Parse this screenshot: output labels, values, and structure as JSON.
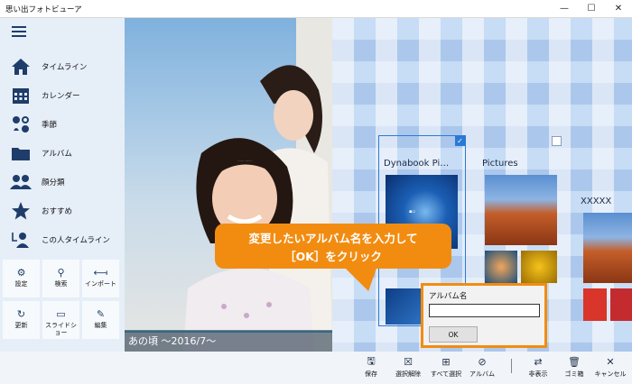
{
  "window": {
    "title": "思い出フォトビューア",
    "controls": {
      "minimize": "—",
      "maximize": "☐",
      "close": "✕"
    }
  },
  "sidebar": {
    "menu_icon": "hamburger-icon",
    "nav": [
      {
        "label": "タイムライン",
        "icon": "home-icon"
      },
      {
        "label": "カレンダー",
        "icon": "calendar-icon"
      },
      {
        "label": "季節",
        "icon": "seasons-icon"
      },
      {
        "label": "アルバム",
        "icon": "folder-icon"
      },
      {
        "label": "顔分類",
        "icon": "faces-icon"
      },
      {
        "label": "おすすめ",
        "icon": "star-icon"
      },
      {
        "label": "この人タイムライン",
        "icon": "person-timeline-icon"
      }
    ],
    "tiles": [
      {
        "label": "設定",
        "icon": "gear-icon",
        "glyph": "⚙"
      },
      {
        "label": "検索",
        "icon": "search-icon",
        "glyph": "⚲"
      },
      {
        "label": "インポート",
        "icon": "import-icon",
        "glyph": "⟻"
      },
      {
        "label": "更新",
        "icon": "refresh-icon",
        "glyph": "↻"
      },
      {
        "label": "スライドショー",
        "icon": "slideshow-icon",
        "glyph": "▭"
      },
      {
        "label": "編集",
        "icon": "edit-icon",
        "glyph": "✎"
      }
    ]
  },
  "photo": {
    "caption": "あの頃 ～2016/7～"
  },
  "albums": [
    {
      "title": "Dynabook Pi…",
      "selected": true,
      "check": "✓"
    },
    {
      "title": "Pictures",
      "selected": false
    },
    {
      "title": "XXXXX",
      "selected": false
    }
  ],
  "callout": {
    "line1": "変更したいアルバム名を入力して",
    "line2": "［OK］をクリック"
  },
  "dialog": {
    "label": "アルバム名",
    "value": "",
    "ok": "OK"
  },
  "toolbar": {
    "items": [
      {
        "label": "保存",
        "icon": "save-icon",
        "glyph": "🖫"
      },
      {
        "label": "選択解除",
        "icon": "deselect-icon",
        "glyph": "☒"
      },
      {
        "label": "すべて選択",
        "icon": "select-all-icon",
        "glyph": "⊞"
      },
      {
        "label": "アルバム",
        "icon": "album-icon",
        "glyph": "⊘"
      },
      {
        "label": "非表示",
        "icon": "hide-icon",
        "glyph": "⇄"
      },
      {
        "label": "ゴミ箱",
        "icon": "trash-icon",
        "glyph": "🗑"
      },
      {
        "label": "キャンセル",
        "icon": "cancel-icon",
        "glyph": "✕"
      }
    ]
  },
  "colors": {
    "accent": "#2b79d6",
    "callout": "#f28c11",
    "sidebar_icon": "#1f3d6a"
  }
}
